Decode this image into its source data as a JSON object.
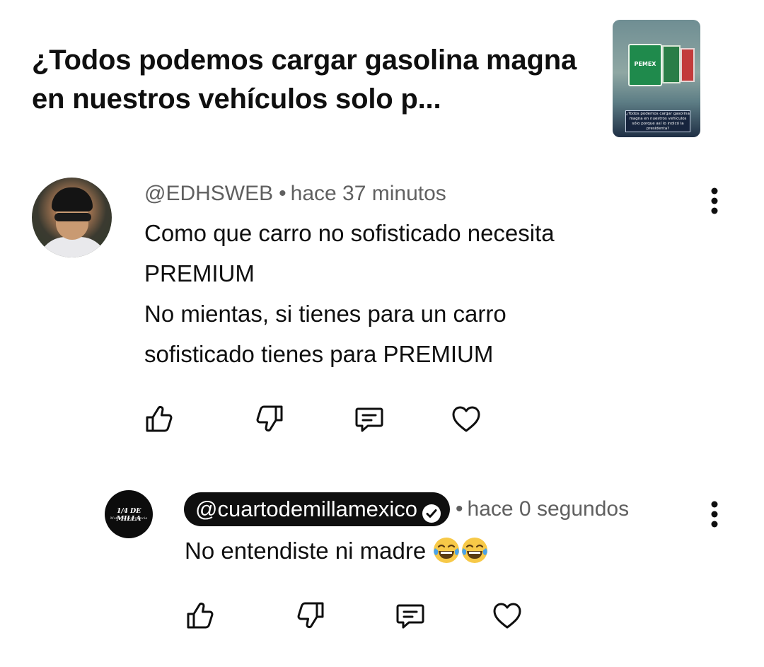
{
  "video": {
    "title": "¿Todos podemos cargar gasolina magna en nuestros vehículos solo p...",
    "thumbnail": {
      "sign_text": "PEMEX",
      "caption": "¿Todos podemos cargar gasolina magna en nuestros vehículos sólo porque así lo indicó la presidenta?"
    }
  },
  "comments": [
    {
      "author": "@EDHSWEB",
      "time": "hace 37 minutos",
      "text": "Como que carro no sofisticado necesita PREMIUM\nNo mientas, si tienes para un carro sofisticado tienes para PREMIUM",
      "lines": [
        "Como que carro no sofisticado necesita",
        "PREMIUM",
        "No mientas, si tienes para un carro",
        "sofisticado tienes para PREMIUM"
      ],
      "avatar_icon": "user-photo"
    },
    {
      "author": "@cuartodemillamexico",
      "author_is_owner": true,
      "verified": true,
      "time": "hace 0 segundos",
      "text": "No entendiste ni madre",
      "emoji": [
        "face-with-tears-of-joy",
        "face-with-tears-of-joy"
      ],
      "avatar_logo": "1/4 DE MILLA",
      "avatar_logo_sub": "Motor & experiencia"
    }
  ],
  "actions": {
    "like_icon": "thumbs-up-icon",
    "dislike_icon": "thumbs-down-icon",
    "reply_icon": "comment-icon",
    "heart_icon": "heart-icon",
    "more_icon": "more-vertical-icon"
  },
  "colors": {
    "text_primary": "#0f0f0f",
    "text_secondary": "#606060",
    "owner_chip_bg": "#0f0f0f",
    "emoji_yellow": "#f7c948",
    "tear_blue": "#4aa3e8"
  }
}
